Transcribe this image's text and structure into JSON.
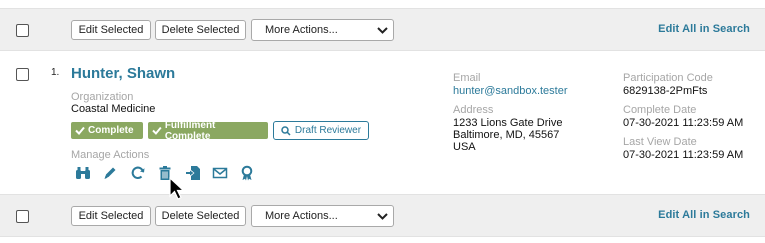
{
  "toolbar": {
    "edit_selected": "Edit Selected",
    "delete_selected": "Delete Selected",
    "more_actions": "More Actions...",
    "edit_all": "Edit All in Search"
  },
  "record": {
    "index": "1.",
    "name": "Hunter, Shawn",
    "organization_label": "Organization",
    "organization": "Coastal Medicine",
    "badges": {
      "complete": "Complete",
      "fulfillment": "Fulfillment Complete",
      "draft_reviewer": "Draft Reviewer"
    },
    "manage_actions_label": "Manage Actions",
    "email_label": "Email",
    "email": "hunter@sandbox.tester",
    "address_label": "Address",
    "address_line1": "1233 Lions Gate Drive",
    "address_line2": "Baltimore, MD, 45567",
    "address_line3": "USA",
    "participation_code_label": "Participation Code",
    "participation_code": "6829138-2PmFts",
    "complete_date_label": "Complete Date",
    "complete_date": "07-30-2021 11:23:59 AM",
    "last_view_date_label": "Last View Date",
    "last_view_date": "07-30-2021 11:23:59 AM"
  },
  "colors": {
    "link": "#2c7a9a",
    "badge_green": "#8ba861",
    "toolbar_bg": "#efefef"
  },
  "icons": [
    "binoculars-icon",
    "pencil-icon",
    "refresh-icon",
    "trash-icon",
    "export-icon",
    "envelope-icon",
    "award-icon",
    "mouse-cursor"
  ]
}
